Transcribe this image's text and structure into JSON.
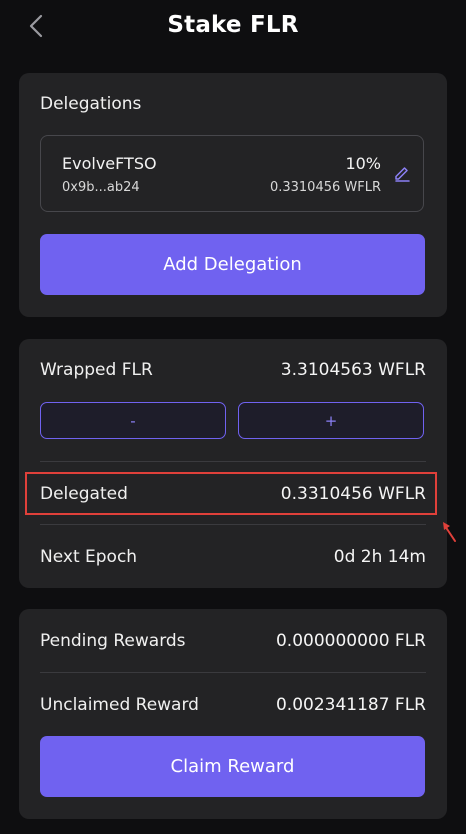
{
  "header": {
    "title": "Stake FLR"
  },
  "delegations": {
    "label": "Delegations",
    "items": [
      {
        "name": "EvolveFTSO",
        "address": "0x9b...ab24",
        "percent": "10%",
        "amount": "0.3310456 WFLR"
      }
    ],
    "add_button_label": "Add Delegation"
  },
  "wrapped": {
    "label": "Wrapped FLR",
    "value": "3.3104563 WFLR",
    "minus_label": "-",
    "plus_label": "+",
    "delegated_label": "Delegated",
    "delegated_value": "0.3310456 WFLR",
    "epoch_label": "Next Epoch",
    "epoch_value": "0d 2h 14m"
  },
  "rewards": {
    "pending_label": "Pending Rewards",
    "pending_value": "0.000000000 FLR",
    "unclaimed_label": "Unclaimed Reward",
    "unclaimed_value": "0.002341187 FLR",
    "claim_button_label": "Claim Reward"
  },
  "colors": {
    "accent": "#7062f0",
    "card": "#232325",
    "background": "#0e0e10",
    "highlight": "#e0403a"
  },
  "icons": {
    "back": "chevron-left-icon",
    "edit": "pencil-icon",
    "pointer": "arrow-icon"
  }
}
